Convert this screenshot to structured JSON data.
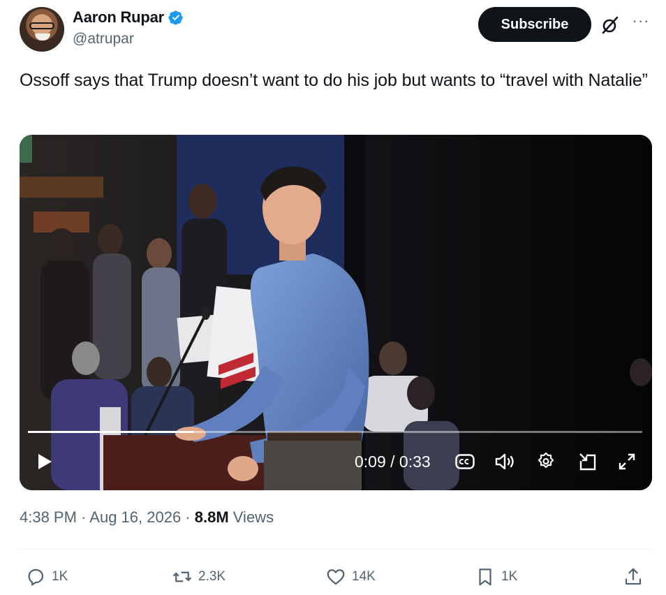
{
  "author": {
    "display_name": "Aaron Rupar",
    "handle": "@atrupar",
    "verified_icon": "verified-badge-icon"
  },
  "header_actions": {
    "subscribe_label": "Subscribe",
    "grok_icon": "grok-icon",
    "more_icon": "more-icon"
  },
  "tweet": {
    "text": "Ossoff says that Trump doesn’t want to do his job but wants to “travel with Natalie”"
  },
  "video": {
    "time_display": "0:09 / 0:33",
    "progress_fraction": 0.27,
    "controls": [
      "play-icon",
      "captions-icon",
      "volume-icon",
      "settings-icon",
      "pip-icon",
      "fullscreen-icon"
    ]
  },
  "meta": {
    "time": "4:38 PM",
    "separator": " · ",
    "date": "Aug 16, 2026",
    "views_count": "8.8M",
    "views_label": " Views"
  },
  "actions": {
    "replies": "1K",
    "reposts": "2.3K",
    "likes": "14K",
    "bookmarks": "1K"
  },
  "colors": {
    "accent": "#1d9bf0",
    "text": "#0f1419",
    "muted": "#536471"
  }
}
